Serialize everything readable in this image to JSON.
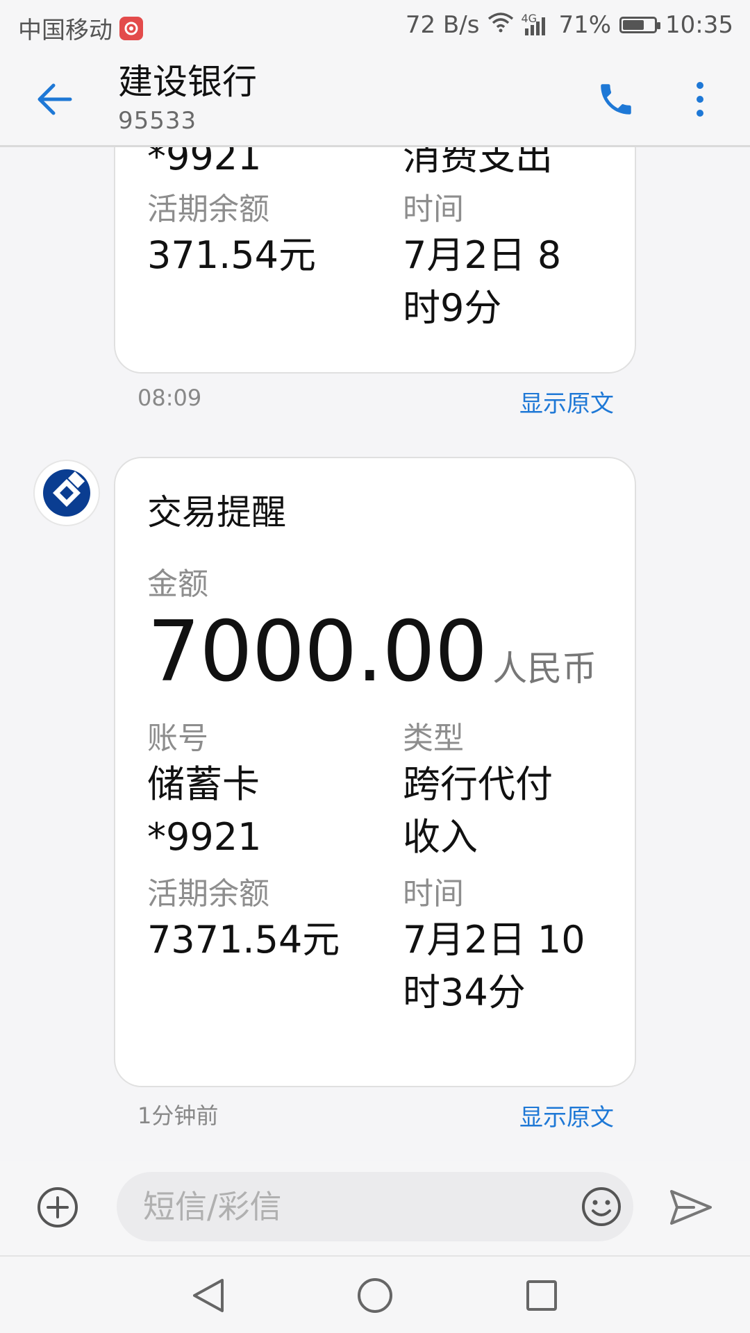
{
  "status_bar": {
    "carrier": "中国移动",
    "speed": "72 B/s",
    "network": "4G",
    "battery": "71%",
    "battery_level": 0.71,
    "time": "10:35"
  },
  "header": {
    "title": "建设银行",
    "subtitle": "95533"
  },
  "messages": [
    {
      "partial_top": {
        "left_value": "*9921",
        "right_value": "消费支出"
      },
      "fields": [
        {
          "label": "活期余额",
          "value": "371.54元"
        },
        {
          "label": "时间",
          "value_line1": "7月2日 8",
          "value_line2": "时9分"
        }
      ],
      "timestamp": "08:09",
      "show_original": "显示原文"
    },
    {
      "title": "交易提醒",
      "amount_label": "金额",
      "amount": "7000.00",
      "currency": "人民币",
      "account_label": "账号",
      "account_line1": "储蓄卡",
      "account_line2": "*9921",
      "type_label": "类型",
      "type_line1": "跨行代付",
      "type_line2": "收入",
      "balance_label": "活期余额",
      "balance": "7371.54元",
      "time_label": "时间",
      "time_line1": "7月2日 10",
      "time_line2": "时34分",
      "timestamp": "1分钟前",
      "show_original": "显示原文"
    }
  ],
  "compose": {
    "placeholder": "短信/彩信",
    "value": ""
  },
  "icons": {
    "back": "arrow-left-icon",
    "call": "phone-icon",
    "more": "more-vertical-icon",
    "add": "plus-circle-icon",
    "emoji": "smiley-icon",
    "send": "send-icon",
    "nav_back": "triangle-back-icon",
    "nav_home": "circle-home-icon",
    "nav_recent": "square-recent-icon",
    "bank_logo": "ccb-logo-icon"
  },
  "colors": {
    "accent": "#1e78d6",
    "bank_blue": "#0a3d91"
  }
}
